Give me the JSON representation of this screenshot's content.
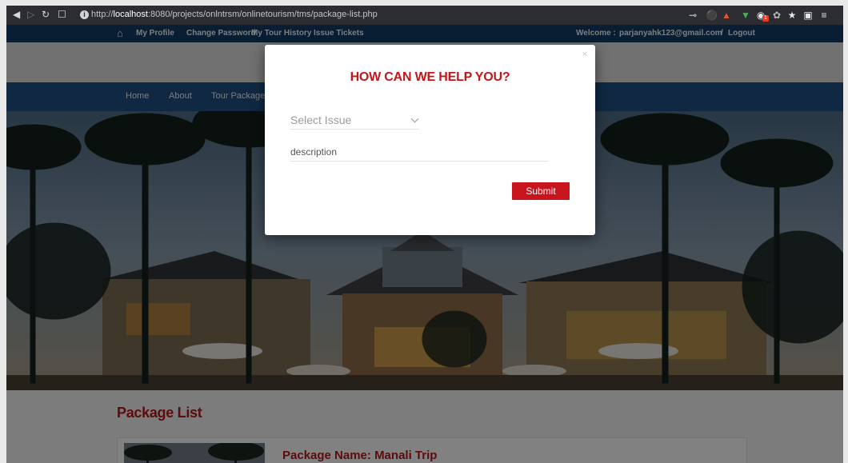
{
  "browser": {
    "url_host": "localhost",
    "url_prefix": "http://",
    "url_rest": ":8080/projects/onlntrsm/onlinetourism/tms/package-list.php",
    "ext_badge": "1"
  },
  "topbar": {
    "my_profile": "My Profile",
    "change_password": "Change Password",
    "my_tour_history": "My Tour History",
    "issue_tickets": "Issue Tickets",
    "welcome_label": "Welcome :",
    "user_email": "parjanyahk123@gmail.com",
    "separator": "/",
    "logout": "Logout"
  },
  "nav": {
    "home": "Home",
    "about": "About",
    "tour_packages": "Tour Packages"
  },
  "section": {
    "title": "Package List"
  },
  "package": {
    "name_line": "Package Name: Manali Trip"
  },
  "modal": {
    "close": "×",
    "heading": "HOW CAN WE HELP YOU?",
    "select_value": "Select Issue",
    "description_placeholder": "description",
    "submit_label": "Submit"
  },
  "colors": {
    "accent_red": "#c3161c",
    "topbar": "#123a61",
    "nav": "#1f4e7f"
  }
}
